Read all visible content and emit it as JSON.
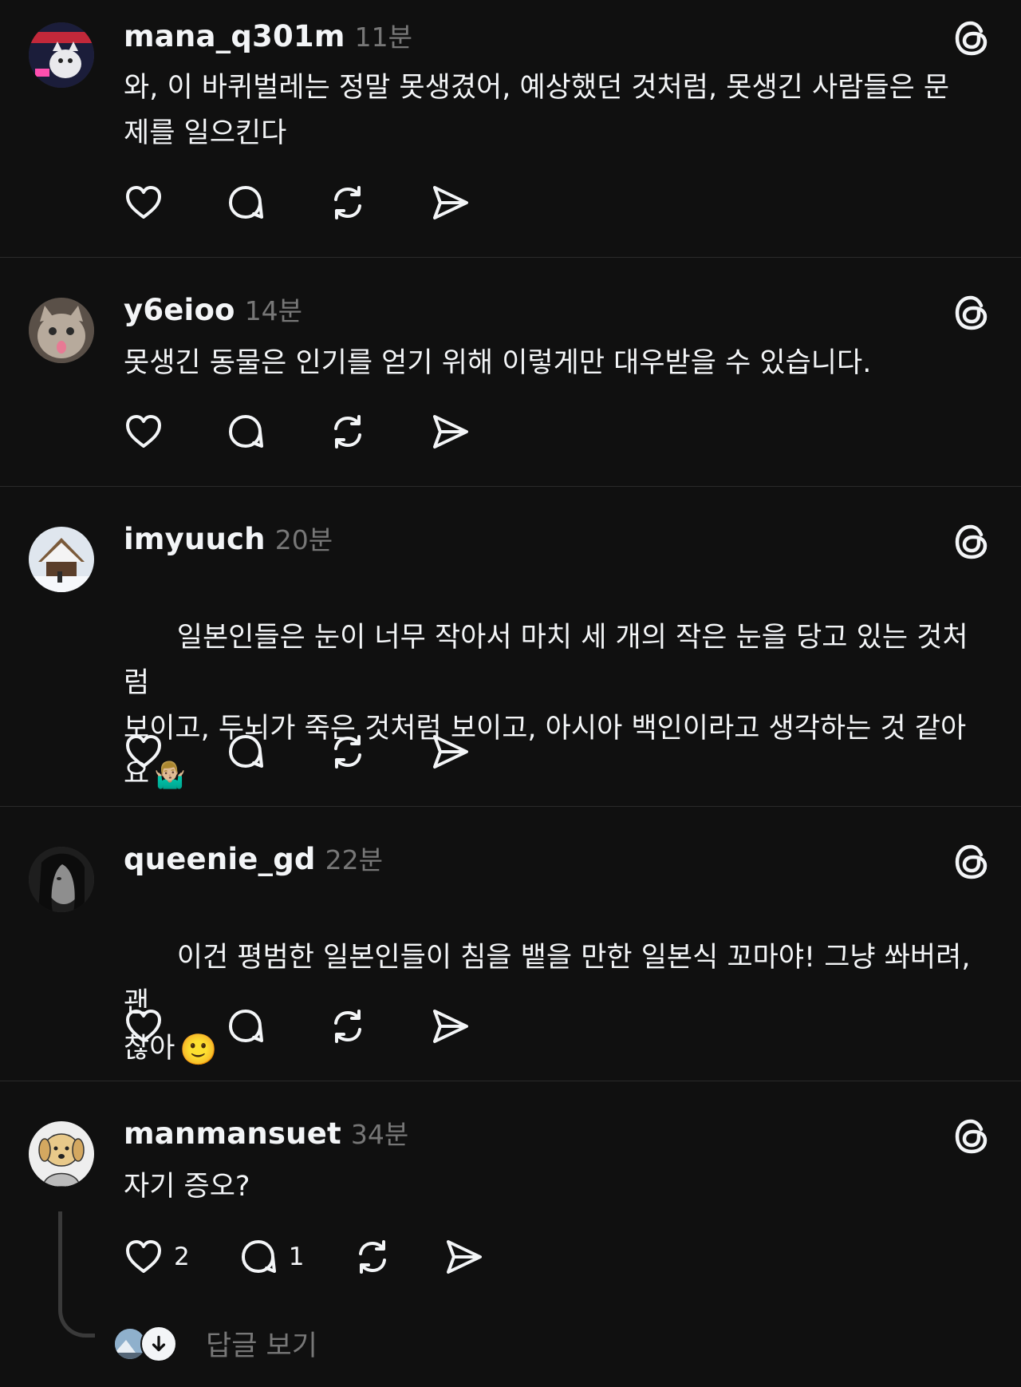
{
  "colors": {
    "background": "#101010",
    "text_primary": "#f3f5f7",
    "text_secondary": "#777777",
    "divider": "#2a2a2a"
  },
  "posts": [
    {
      "username": "mana_q301m",
      "time": "11분",
      "text": "와, 이 바퀴벌레는 정말 못생겼어, 예상했던 것처럼, 못생긴 사람들은 문\n제를 일으킨다",
      "avatar_icon": "avatar-cat-collage-icon"
    },
    {
      "username": "y6eioo",
      "time": "14분",
      "text": "못생긴 동물은 인기를 얻기 위해 이렇게만 대우받을 수 있습니다.",
      "avatar_icon": "avatar-cat-tongue-icon"
    },
    {
      "username": "imyuuch",
      "time": "20분",
      "text": "일본인들은 눈이 너무 작아서 마치 세 개의 작은 눈을 당고 있는 것처럼\n보이고, 두뇌가 죽은 것처럼 보이고, 아시아 백인이라고 생각하는 것 같아\n요",
      "emoji": "🤷🏼‍♂️",
      "avatar_icon": "avatar-snow-house-icon"
    },
    {
      "username": "queenie_gd",
      "time": "22분",
      "text": "이건 평범한 일본인들이 침을 뱉을 만한 일본식 꼬마야! 그냥 쏴버려, 괜\n찮아",
      "emoji": "🙂",
      "avatar_icon": "avatar-portrait-bw-icon"
    },
    {
      "username": "manmansuet",
      "time": "34분",
      "text": "자기 증오?",
      "like_count": "2",
      "reply_count": "1",
      "avatar_icon": "avatar-dog-sketch-icon",
      "view_replies": "답글 보기"
    }
  ]
}
